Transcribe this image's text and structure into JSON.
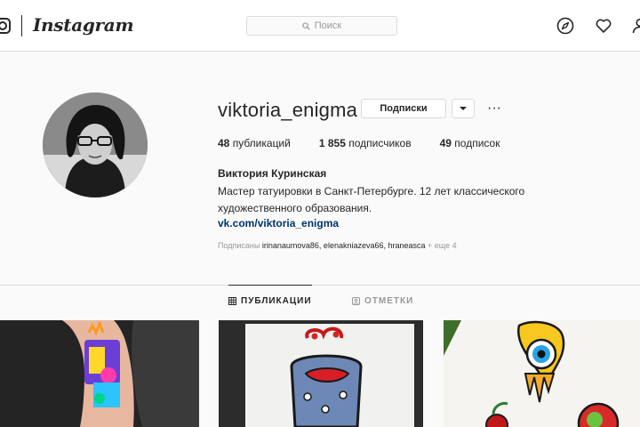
{
  "header": {
    "brand": "Instagram",
    "search_placeholder": "Поиск"
  },
  "profile": {
    "username": "viktoria_enigma",
    "follow_button": "Подписки",
    "more_glyph": "···",
    "stats": [
      {
        "value": "48",
        "label": "публикаций"
      },
      {
        "value": "1 855",
        "label": "подписчиков"
      },
      {
        "value": "49",
        "label": "подписок"
      }
    ],
    "full_name": "Виктория Куринская",
    "bio": "Мастер татуировки в Санкт-Петербурге. 12 лет классического художественного образования.",
    "link": "vk.com/viktoria_enigma",
    "followed_by_prefix": "Подписаны",
    "followed_by_users": "irinanaumova86, elenakniazeva66, hraneasca",
    "followed_by_more": "+ еще 4"
  },
  "tabs": [
    {
      "label": "ПУБЛИКАЦИИ",
      "active": true
    },
    {
      "label": "ОТМЕТКИ",
      "active": false
    }
  ],
  "icons": [
    "instagram-glyph-icon",
    "search-icon",
    "explore-compass-icon",
    "heart-icon",
    "profile-icon",
    "chevron-down-icon",
    "grid-icon",
    "tag-icon"
  ]
}
